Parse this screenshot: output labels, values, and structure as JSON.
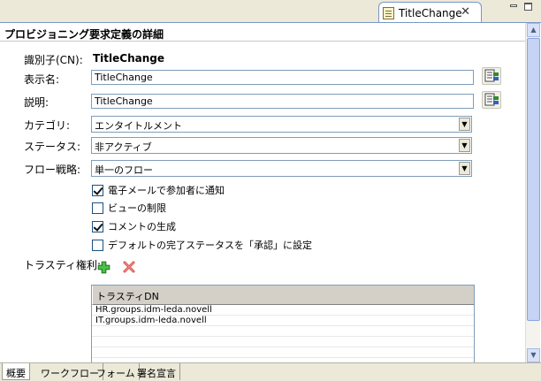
{
  "editor_tab": {
    "title": "TitleChange",
    "icon": "document-icon",
    "close": "✕"
  },
  "section": {
    "title": "プロビジョニング要求定義の詳細"
  },
  "fields": {
    "cn_label": "識別子(CN):",
    "cn_value": "TitleChange",
    "display_name_label": "表示名:",
    "display_name_value": "TitleChange",
    "description_label": "説明:",
    "description_value": "TitleChange",
    "category_label": "カテゴリ:",
    "category_value": "エンタイトルメント",
    "status_label": "ステータス:",
    "status_value": "非アクティブ",
    "flow_label": "フロー戦略:",
    "flow_value": "単一のフロー"
  },
  "options": [
    {
      "label": "電子メールで参加者に通知",
      "checked": true
    },
    {
      "label": "ビューの制限",
      "checked": false
    },
    {
      "label": "コメントの生成",
      "checked": true
    },
    {
      "label": "デフォルトの完了ステータスを「承認」に設定",
      "checked": false
    }
  ],
  "trustee": {
    "label": "トラスティ権利:",
    "column": "トラスティDN",
    "rows": [
      "HR.groups.idm-leda.novell",
      "IT.groups.idm-leda.novell"
    ]
  },
  "bottom_tabs": [
    "概要",
    "ワークフロー",
    "フォーム",
    "署名宣言"
  ],
  "colors": {
    "accent_border": "#7f9db9",
    "chrome": "#ece9d8",
    "add_green": "#2e9b2e",
    "delete_red": "#d9534f"
  }
}
